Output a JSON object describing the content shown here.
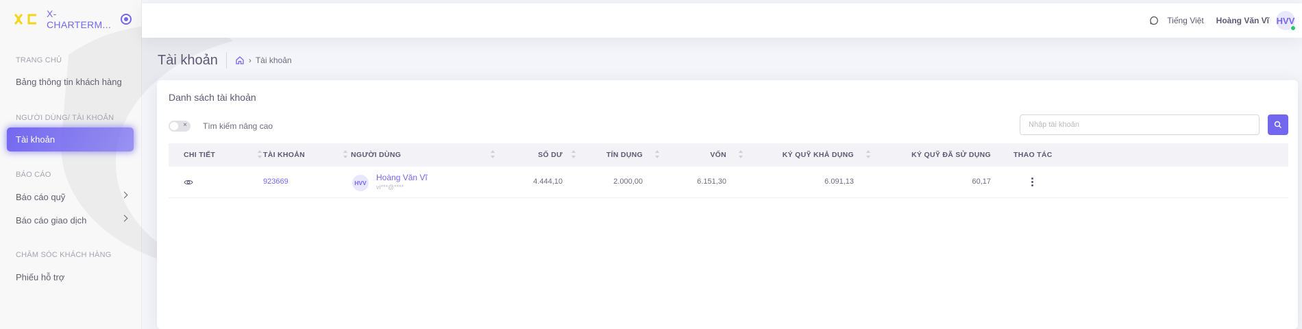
{
  "brand": {
    "name": "X-CHARTERM..."
  },
  "sidebar": {
    "sections": [
      {
        "title": "TRANG CHỦ",
        "items": [
          {
            "label": "Bảng thông tin khách hàng"
          }
        ]
      },
      {
        "title": "NGƯỜI DÙNG/ TÀI KHOẢN",
        "items": [
          {
            "label": "Tài khoản",
            "active": true
          }
        ]
      },
      {
        "title": "BÁO CÁO",
        "items": [
          {
            "label": "Báo cáo quỹ"
          },
          {
            "label": "Báo cáo giao dịch"
          }
        ]
      },
      {
        "title": "CHĂM SÓC KHÁCH HÀNG",
        "items": [
          {
            "label": "Phiếu hỗ trợ"
          }
        ]
      }
    ]
  },
  "header": {
    "language": "Tiếng Việt",
    "user_name": "Hoàng Văn Vĩ",
    "avatar_initials": "HVV"
  },
  "breadcrumb": {
    "title": "Tài khoản",
    "current": "Tài khoản"
  },
  "card": {
    "title": "Danh sách tài khoản",
    "advanced_search_label": "Tìm kiếm nâng cao",
    "search_placeholder": "Nhập tài khoản"
  },
  "table": {
    "columns": [
      "CHI TIẾT",
      "TÀI KHOẢN",
      "NGƯỜI DÙNG",
      "SỐ DƯ",
      "TÍN DỤNG",
      "VỐN",
      "KÝ QUỸ KHẢ DỤNG",
      "KÝ QUỸ ĐÃ SỬ DỤNG",
      "THAO TÁC"
    ],
    "rows": [
      {
        "account": "923669",
        "user_initials": "HVV",
        "user_name": "Hoàng Văn Vĩ",
        "user_email": "vi***@****",
        "balance": "4.444,10",
        "credit": "2.000,00",
        "equity": "6.151,30",
        "free_margin": "6.091,13",
        "used_margin": "60,17"
      }
    ]
  },
  "colors": {
    "accent": "#7367f0",
    "online": "#28c76f"
  }
}
